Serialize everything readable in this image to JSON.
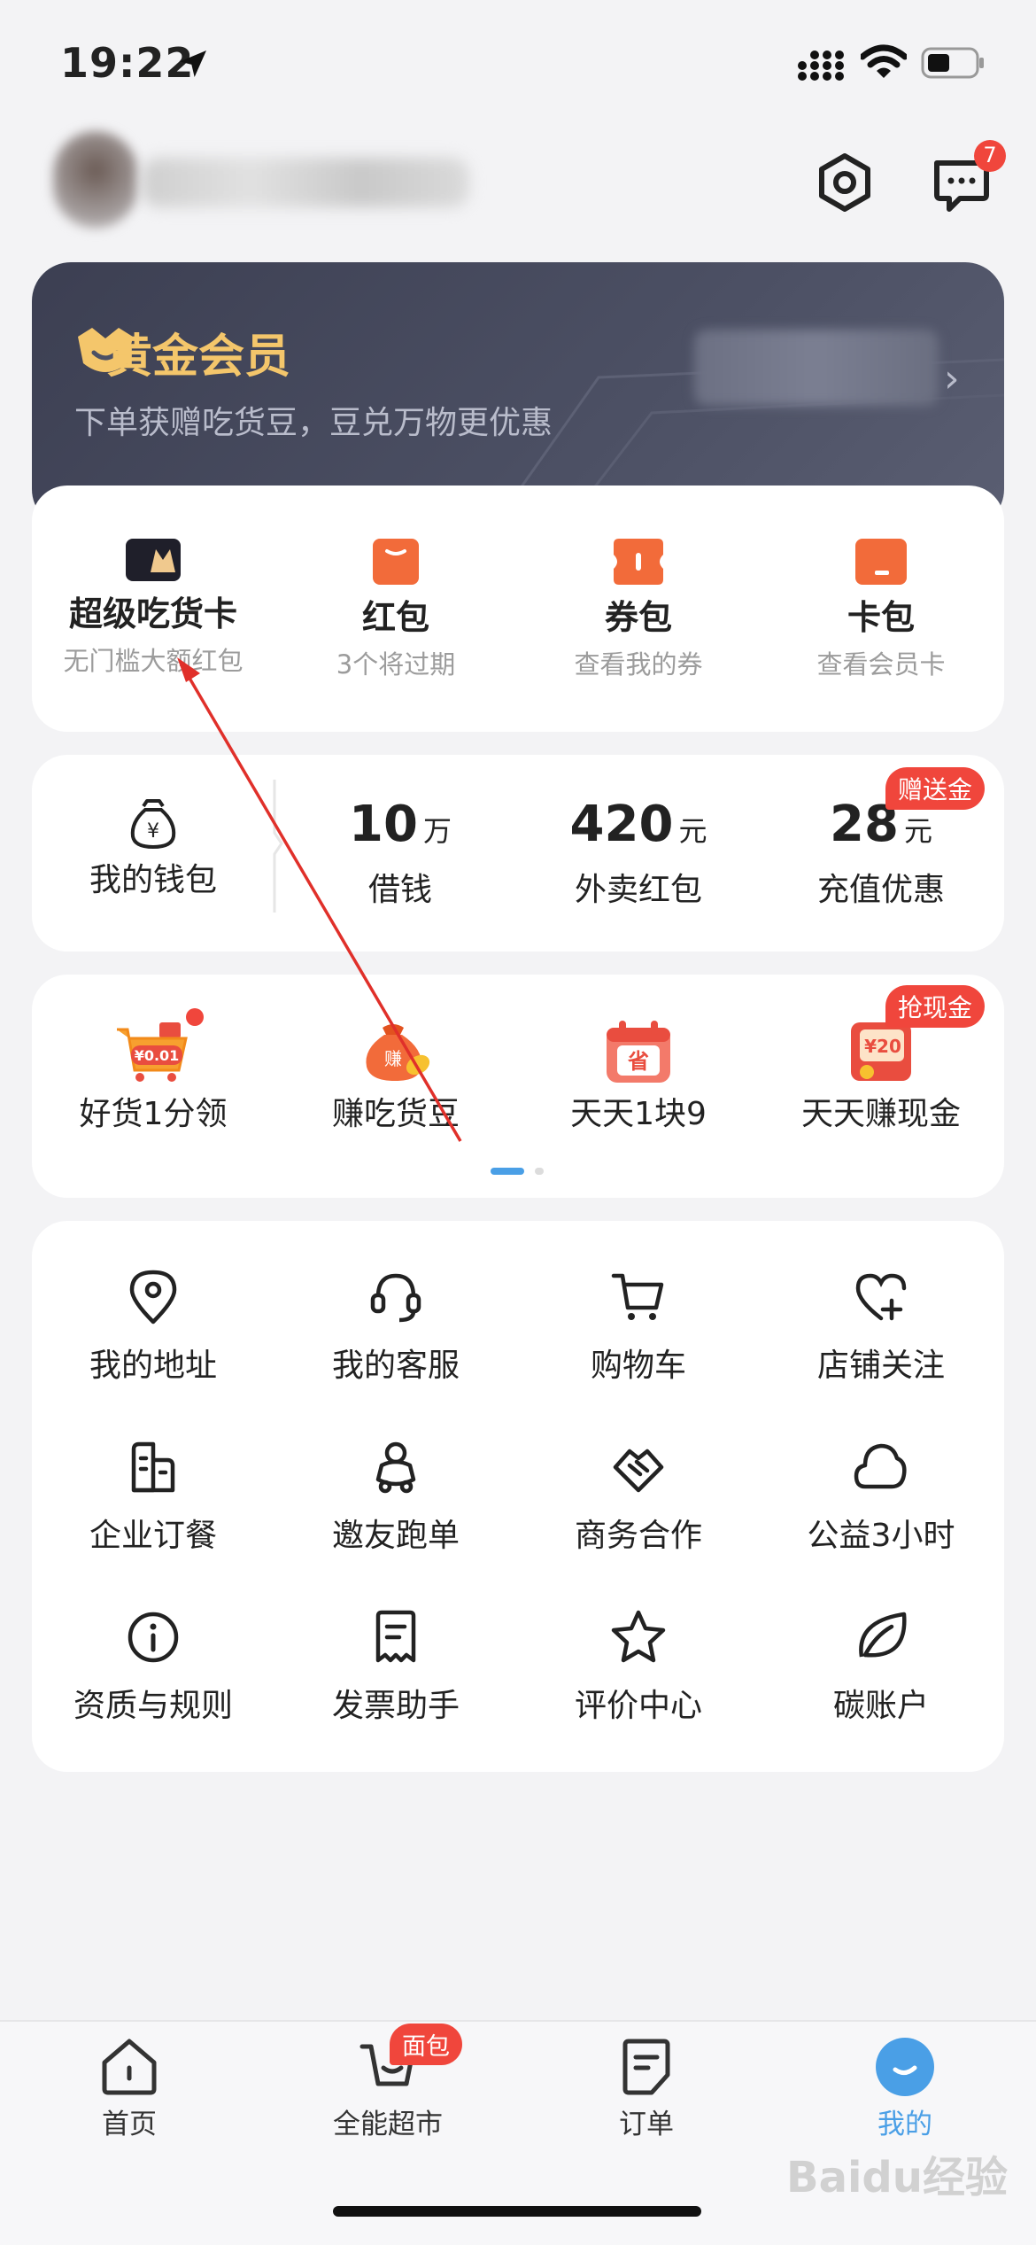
{
  "status_bar": {
    "time": "19:22"
  },
  "header": {
    "message_badge": "7"
  },
  "gold_card": {
    "title": "黄金会员",
    "subtitle": "下单获赠吃货豆，豆兑万物更优惠"
  },
  "benefits": [
    {
      "title": "超级吃货卡",
      "sub": "无门槛大额红包"
    },
    {
      "title": "红包",
      "sub": "3个将过期"
    },
    {
      "title": "券包",
      "sub": "查看我的券"
    },
    {
      "title": "卡包",
      "sub": "查看会员卡"
    }
  ],
  "finance": {
    "wallet_label": "我的钱包",
    "items": [
      {
        "value": "10",
        "unit": "万",
        "label": "借钱"
      },
      {
        "value": "420",
        "unit": "元",
        "label": "外卖红包"
      },
      {
        "value": "28",
        "unit": "元",
        "label": "充值优惠",
        "tag": "赠送金"
      }
    ]
  },
  "activities": [
    {
      "label": "好货1分领",
      "icon_text": "¥0.01"
    },
    {
      "label": "赚吃货豆",
      "icon_text": "赚"
    },
    {
      "label": "天天1块9",
      "icon_text": "省"
    },
    {
      "label": "天天赚现金",
      "icon_text": "¥20",
      "tag": "抢现金"
    }
  ],
  "services": [
    {
      "label": "我的地址",
      "icon": "location-icon"
    },
    {
      "label": "我的客服",
      "icon": "headset-icon"
    },
    {
      "label": "购物车",
      "icon": "cart-icon"
    },
    {
      "label": "店铺关注",
      "icon": "heart-plus-icon"
    },
    {
      "label": "企业订餐",
      "icon": "building-icon"
    },
    {
      "label": "邀友跑单",
      "icon": "rider-icon"
    },
    {
      "label": "商务合作",
      "icon": "handshake-icon"
    },
    {
      "label": "公益3小时",
      "icon": "cloud-icon"
    },
    {
      "label": "资质与规则",
      "icon": "info-icon"
    },
    {
      "label": "发票助手",
      "icon": "invoice-icon"
    },
    {
      "label": "评价中心",
      "icon": "star-icon"
    },
    {
      "label": "碳账户",
      "icon": "leaf-icon"
    }
  ],
  "tabbar": {
    "items": [
      {
        "label": "首页"
      },
      {
        "label": "全能超市",
        "badge": "面包"
      },
      {
        "label": "订单"
      },
      {
        "label": "我的"
      }
    ]
  },
  "watermark": "Baidu经验",
  "colors": {
    "accent": "#4a9fe6",
    "red": "#f0463c",
    "orange": "#f26b3a",
    "gold": "#f4c66b"
  }
}
